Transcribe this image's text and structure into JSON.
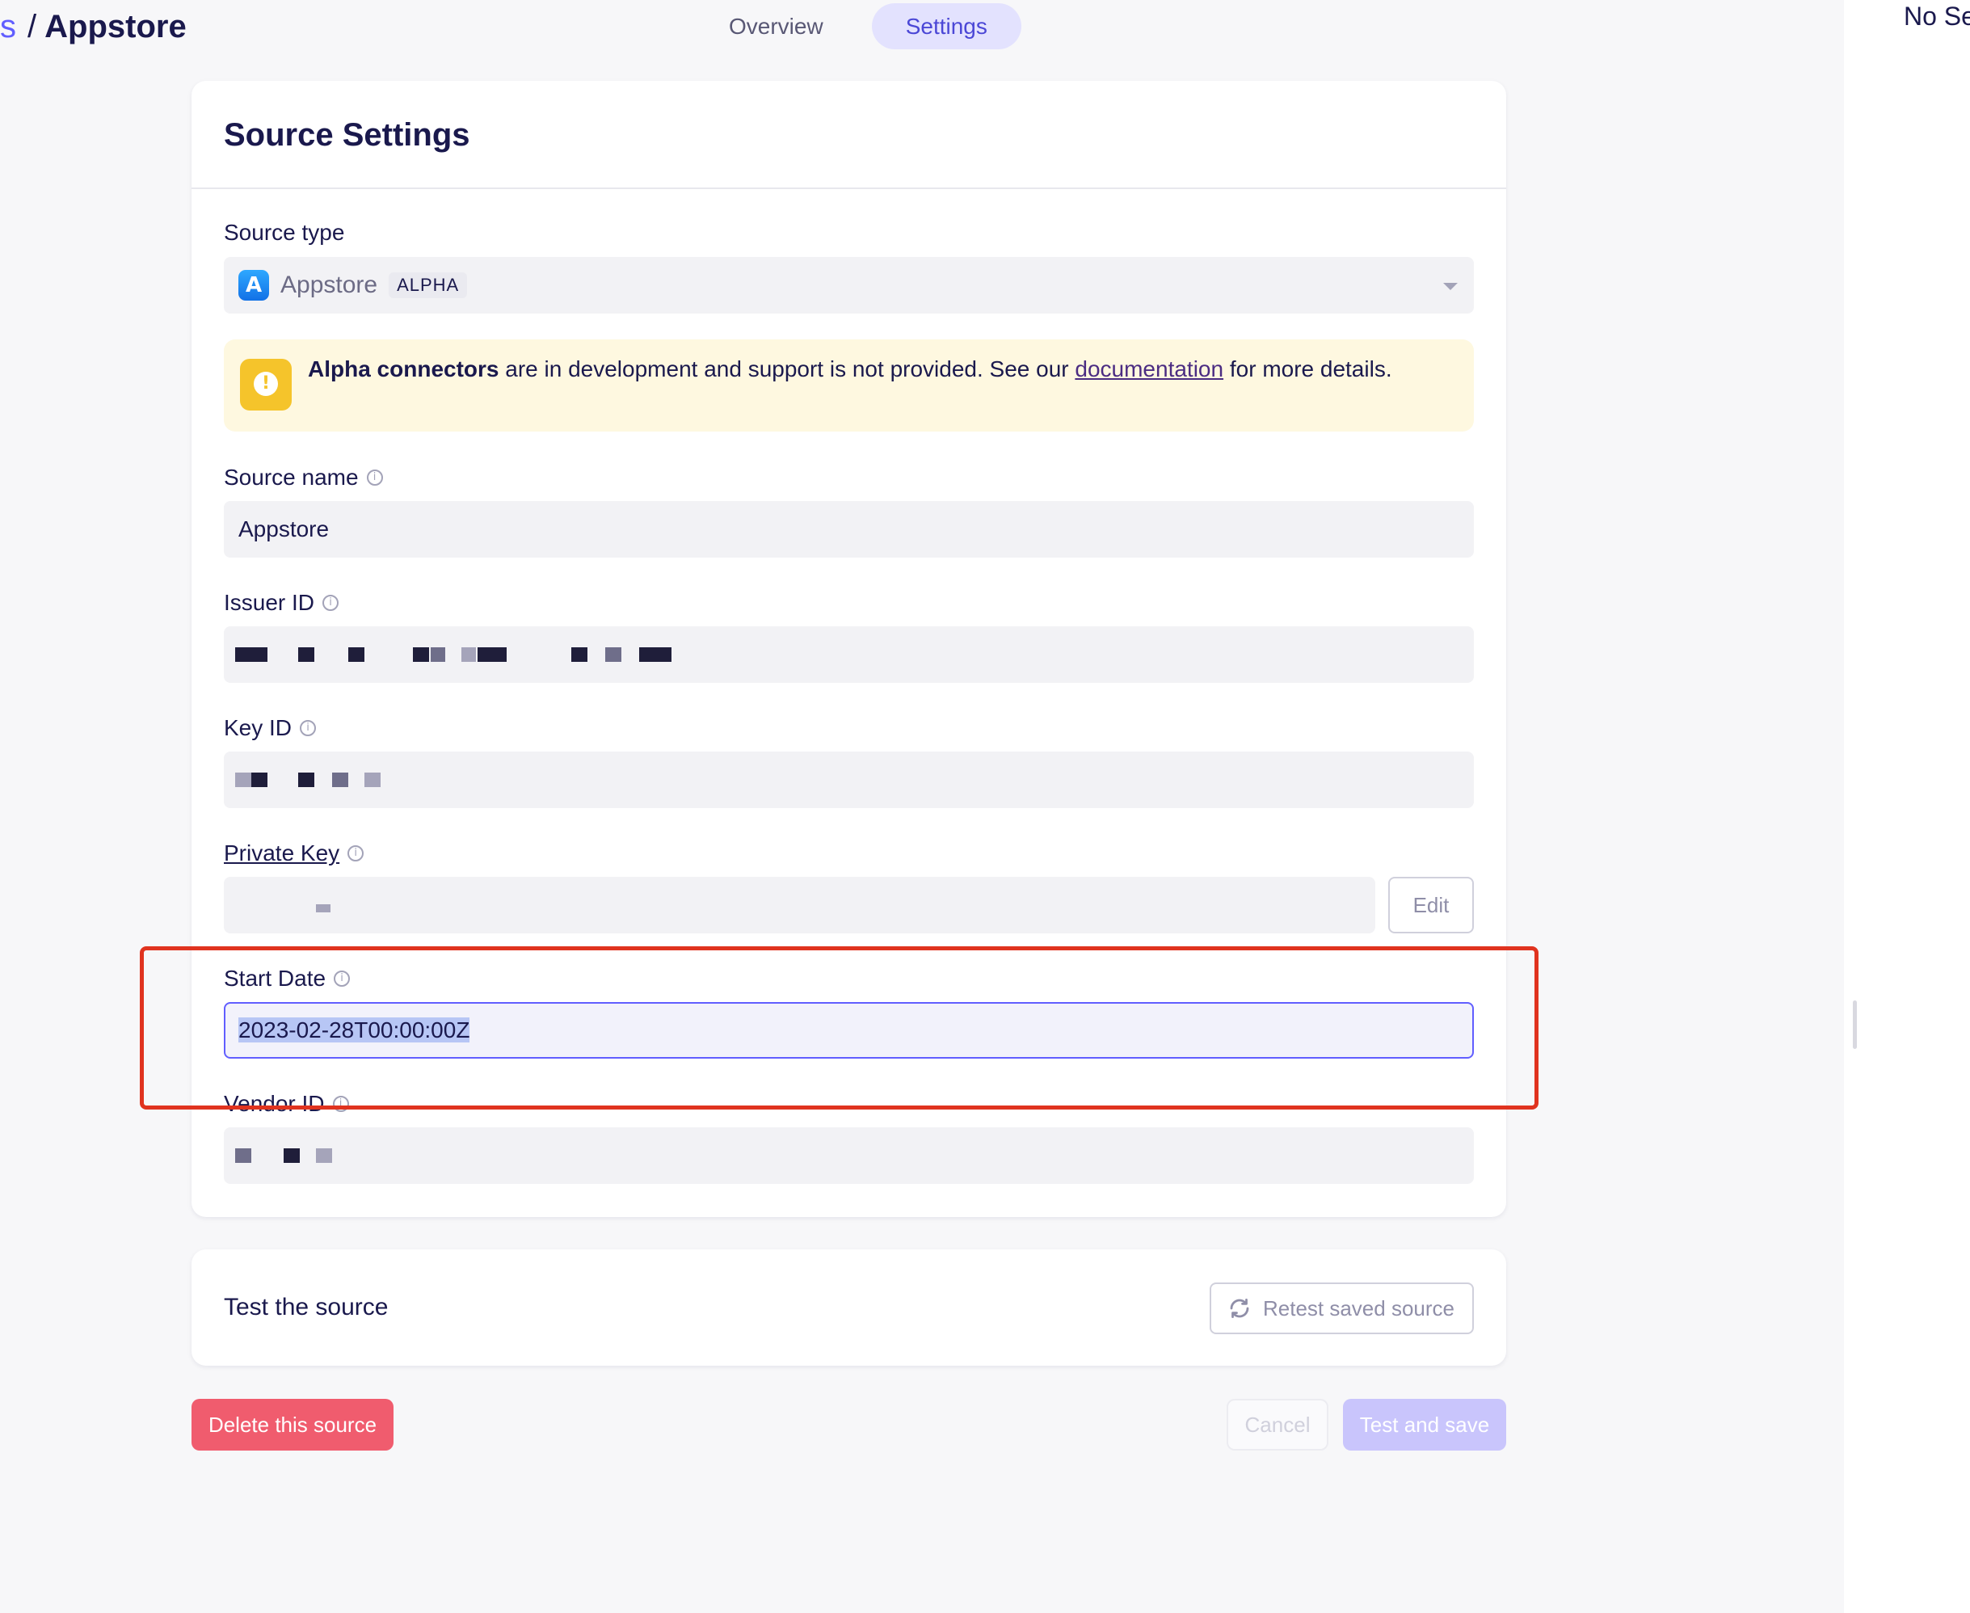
{
  "header": {
    "breadcrumb_prev": "s",
    "breadcrumb_sep": "/",
    "breadcrumb_current": "Appstore",
    "tabs": [
      {
        "label": "Overview",
        "active": false
      },
      {
        "label": "Settings",
        "active": true
      }
    ]
  },
  "right_panel": {
    "text": "No Se"
  },
  "settings_card": {
    "title": "Source Settings",
    "source_type": {
      "label": "Source type",
      "value": "Appstore",
      "badge": "ALPHA",
      "icon": "app-store-icon"
    },
    "alert": {
      "bold": "Alpha connectors",
      "text_before_link": " are in development and support is not provided. See our ",
      "link": "documentation",
      "text_after_link": " for more details.",
      "icon": "warning-icon",
      "color": "#f5c42b"
    },
    "source_name": {
      "label": "Source name",
      "value": "Appstore"
    },
    "issuer_id": {
      "label": "Issuer ID"
    },
    "key_id": {
      "label": "Key ID"
    },
    "private_key": {
      "label": "Private Key",
      "edit_label": "Edit"
    },
    "start_date": {
      "label": "Start Date",
      "value": "2023-02-28T00:00:00Z"
    },
    "vendor_id": {
      "label": "Vendor ID"
    }
  },
  "test_card": {
    "label": "Test the source",
    "retest_label": "Retest saved source"
  },
  "actions": {
    "delete_label": "Delete this source",
    "cancel_label": "Cancel",
    "save_label": "Test and save"
  },
  "colors": {
    "accent": "#615eff",
    "danger": "#f05c6e",
    "highlight": "#e0331f"
  }
}
